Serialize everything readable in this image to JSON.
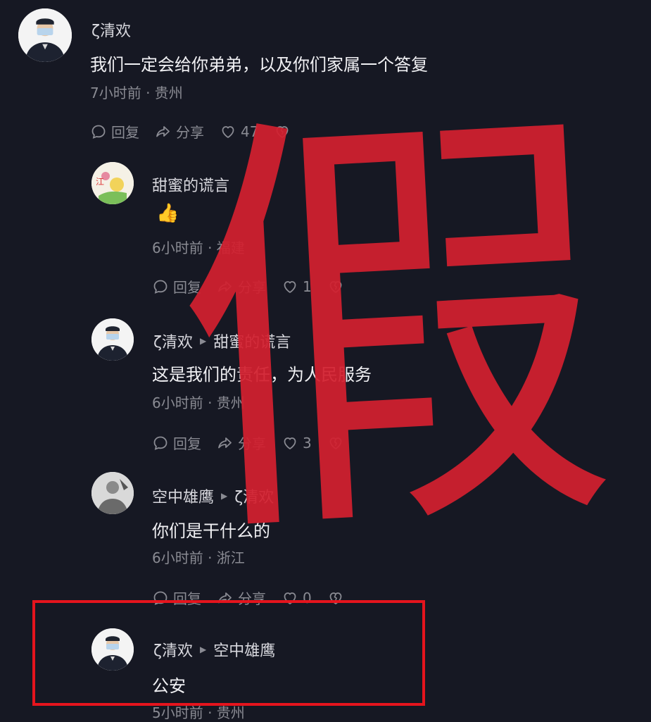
{
  "comments": [
    {
      "author": "ζ清欢",
      "text": "我们一定会给你弟弟，以及你们家属一个答复",
      "meta": "7小时前 · 贵州",
      "actions": {
        "reply": "回复",
        "share": "分享",
        "likes": "47"
      }
    },
    {
      "author": "甜蜜的谎言",
      "emoji": "👍",
      "meta": "6小时前 · 福建",
      "actions": {
        "reply": "回复",
        "share": "分享",
        "likes": "1"
      }
    },
    {
      "author": "ζ清欢",
      "reply_to": "甜蜜的谎言",
      "text": "这是我们的责任，为人民服务",
      "meta": "6小时前 · 贵州",
      "actions": {
        "reply": "回复",
        "share": "分享",
        "likes": "3"
      }
    },
    {
      "author": "空中雄鹰",
      "reply_to": "ζ清欢",
      "text": "你们是干什么的",
      "meta": "6小时前 · 浙江",
      "actions": {
        "reply": "回复",
        "share": "分享",
        "likes": "0"
      }
    },
    {
      "author": "ζ清欢",
      "reply_to": "空中雄鹰",
      "text": "公安",
      "meta": "5小时前 · 贵州"
    }
  ],
  "stamp_text": "假",
  "colors": {
    "background": "#161823",
    "stamp": "#d3202f",
    "highlight_box": "#e5141d",
    "meta_text": "#8a8b93"
  },
  "icons": [
    "comment-bubble-icon",
    "share-arrow-icon",
    "heart-icon",
    "broken-heart-icon",
    "reply-arrow-icon"
  ]
}
